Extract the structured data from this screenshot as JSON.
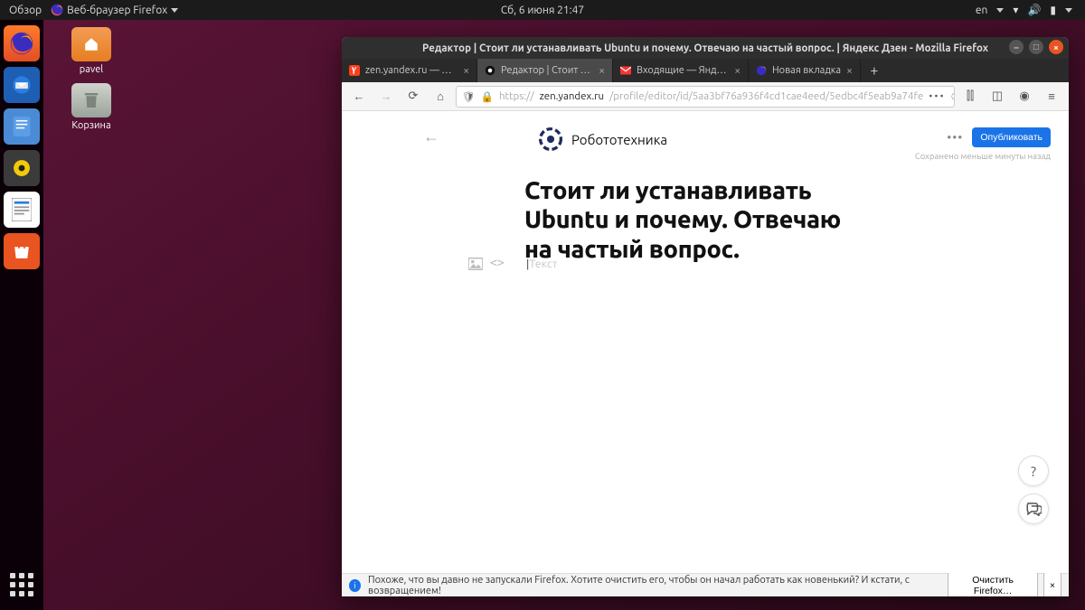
{
  "top_panel": {
    "activities": "Обзор",
    "app_name": "Веб-браузер Firefox",
    "clock": "Сб, 6 июня  21:47",
    "lang": "en"
  },
  "desktop": {
    "home_folder": "pavel",
    "trash": "Корзина"
  },
  "firefox": {
    "window_title": "Редактор | Стоит ли устанавливать Ubuntu и почему. Отвечаю на частый вопрос. | Яндекс Дзен - Mozilla Firefox",
    "tabs": [
      {
        "label": "zen.yandex.ru — Яндекс"
      },
      {
        "label": "Редактор | Стоит ли уст"
      },
      {
        "label": "Входящие — Яндекс.По"
      },
      {
        "label": "Новая вкладка"
      }
    ],
    "url_prefix": "https://",
    "url_host": "zen.yandex.ru",
    "url_path": "/profile/editor/id/5aa3bf76a936f4cd1cae4eed/5edbc4f5eab9a74fe",
    "notif_text": "Похоже, что вы давно не запускали Firefox. Хотите очистить его, чтобы он начал работать как новенький? И кстати, с возвращением!",
    "notif_btn": "Очистить Firefox…"
  },
  "editor": {
    "channel": "Робототехника",
    "publish": "Опубликовать",
    "saved": "Сохранено меньше минуты назад",
    "title": "Стоит ли устанавливать Ubuntu и почему. Отвечаю на частый вопрос.",
    "placeholder": "Текст",
    "help": "?"
  }
}
